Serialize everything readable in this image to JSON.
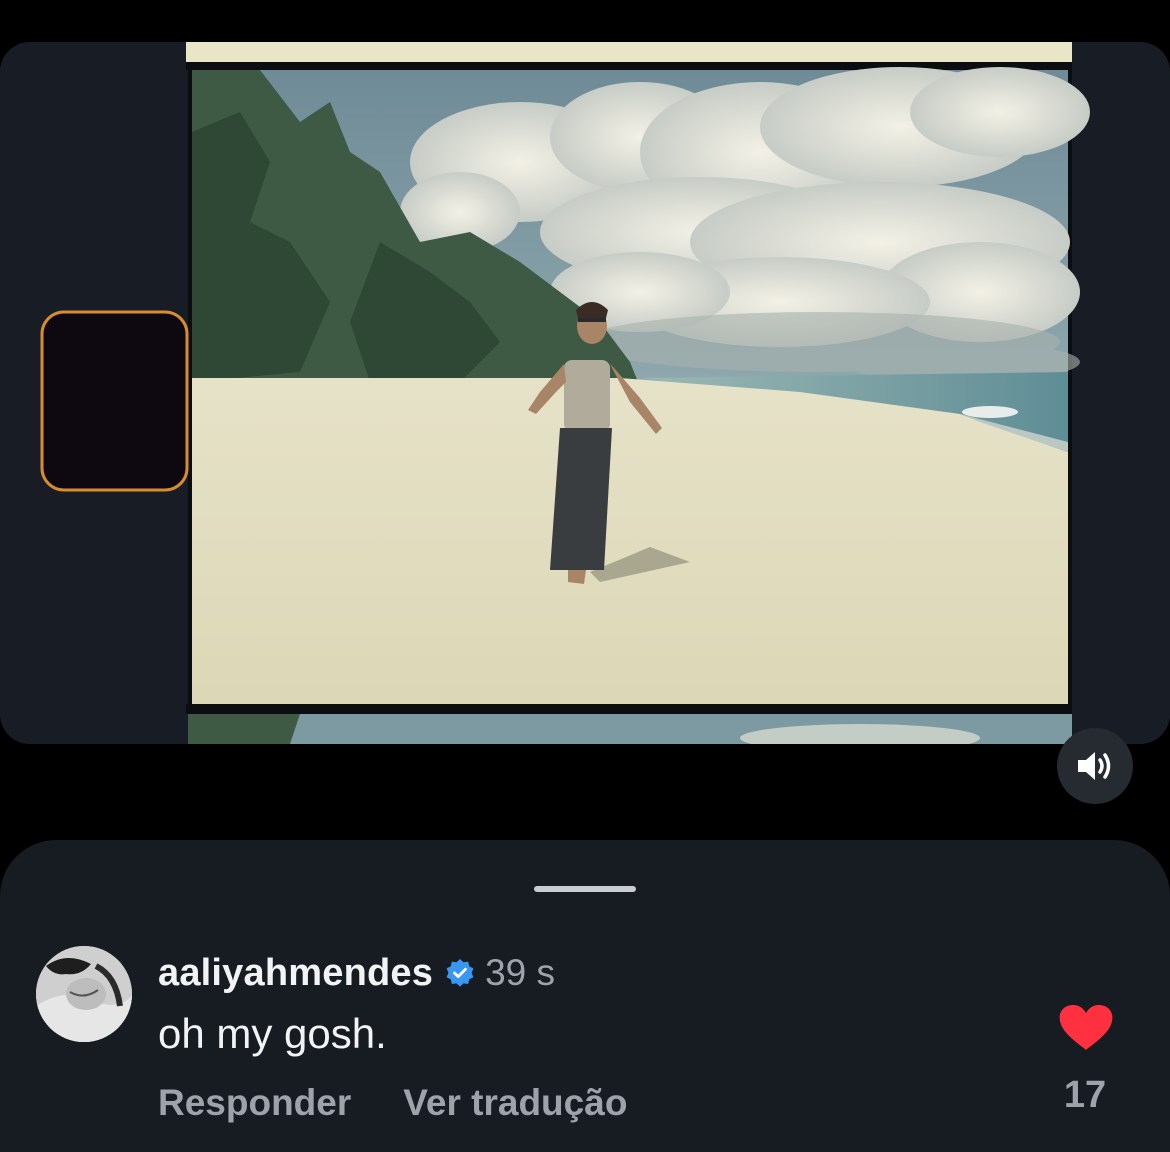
{
  "video": {
    "sound_icon": "speaker-wave-icon",
    "frame_description_alt": ""
  },
  "comment": {
    "username": "aaliyahmendes",
    "verified_icon": "verified-badge-icon",
    "timestamp": "39 s",
    "text": "oh my gosh.",
    "reply_label": "Responder",
    "translate_label": "Ver tradução",
    "like_icon": "heart-filled-icon",
    "like_count": "17"
  },
  "colors": {
    "background": "#000000",
    "sheet": "#171b22",
    "primary_text": "#f2f3f5",
    "secondary_text": "#9ea3ab",
    "verified_blue": "#3897f0",
    "like_red": "#ff3040"
  }
}
